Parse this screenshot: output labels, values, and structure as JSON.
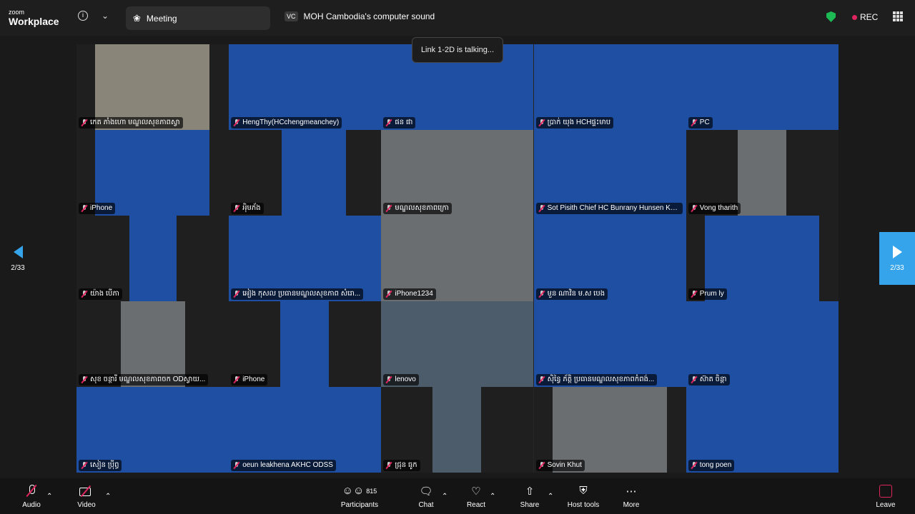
{
  "brand": {
    "line1": "zoom",
    "line2": "Workplace"
  },
  "tabs": {
    "meeting": "Meeting",
    "speaker_badge": "VC",
    "speaker": "MOH Cambodia's computer sound"
  },
  "status": {
    "rec": "REC",
    "talking": "Link 1-2D is talking..."
  },
  "pager": {
    "left": "2/33",
    "right": "2/33"
  },
  "tiles": [
    {
      "label": "កេត ភាំងហោ  មណ្ឌលសុខភាពស្វា"
    },
    {
      "label": "HengThy(HCchengmeanchey)"
    },
    {
      "label": "ផន ផា"
    },
    {
      "label": "ប្រាក់ យុង HCHផ្ទះមាប"
    },
    {
      "label": "PC"
    },
    {
      "label": "iPhone"
    },
    {
      "label": "អុិមភ័ង"
    },
    {
      "label": "មណ្ឌលសុខភាពក្រោ"
    },
    {
      "label": "Sot Pisith Chief HC Bunrany Hunsen Ko..."
    },
    {
      "label": "Vong tharith"
    },
    {
      "label": "យ៉ាង បើភា"
    },
    {
      "label": "អៀង កុសល ប្រធានមណ្ឌលសុខភាព សំរោ..."
    },
    {
      "label": "iPhone1234"
    },
    {
      "label": "មួន ណាវិន ម.ស បេង"
    },
    {
      "label": "Prum ly"
    },
    {
      "label": "សុខ ចន្ថារី  មណ្ឌលសុខភាពចក ODស្វាយ..."
    },
    {
      "label": "iPhone"
    },
    {
      "label": "lenovo"
    },
    {
      "label": "ស៊ិន្វៃ ភ័ត្តិ ប្រធានមណ្ឌលសុខភាពកំពង់..."
    },
    {
      "label": "ស៊ាត ចិន្តា"
    },
    {
      "label": "សៀន ប្រុីព្ធ"
    },
    {
      "label": "oeun leakhena AKHC ODSS"
    },
    {
      "label": "ជ្រុន ធូក"
    },
    {
      "label": "Sovin Khut"
    },
    {
      "label": "tong poen"
    }
  ],
  "toolbar": {
    "audio": "Audio",
    "video": "Video",
    "participants": "Participants",
    "participants_count": "815",
    "chat": "Chat",
    "react": "React",
    "share": "Share",
    "host_tools": "Host tools",
    "more": "More",
    "leave": "Leave"
  },
  "colors": {
    "slide_blue": "#1f4fa3",
    "accent": "#35a4ea",
    "mute_red": "#e0245e",
    "secure_green": "#1db954"
  },
  "icons": [
    "info-icon",
    "chevron-down-icon",
    "paw-icon",
    "shield-icon",
    "apps-icon",
    "mic-off-icon",
    "video-off-icon",
    "participants-icon",
    "chat-icon",
    "react-icon",
    "share-icon",
    "host-tools-icon",
    "more-icon",
    "leave-icon"
  ]
}
